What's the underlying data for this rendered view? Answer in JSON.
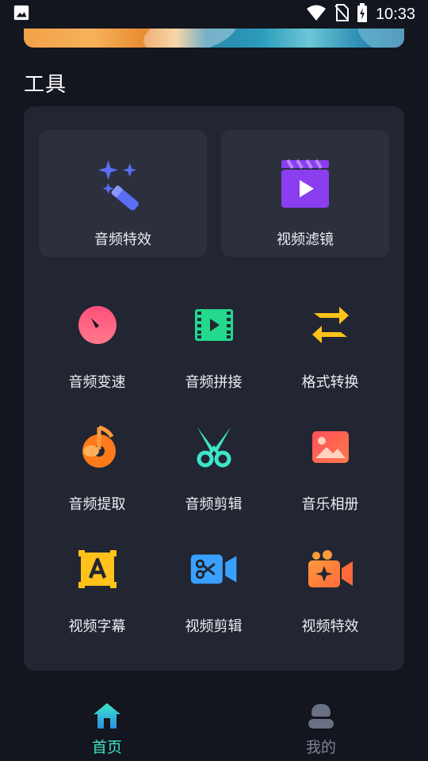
{
  "status_bar": {
    "time": "10:33",
    "icons": [
      "image-icon",
      "wifi-icon",
      "no-sim-icon",
      "battery-charging-icon"
    ]
  },
  "banner": {
    "visible": true
  },
  "tools": {
    "section_title": "工具",
    "featured": [
      {
        "label": "音频特效",
        "icon": "magic-wand-icon",
        "color": "#5b6cf5"
      },
      {
        "label": "视频滤镜",
        "icon": "clapperboard-icon",
        "color": "#8b3df0"
      }
    ],
    "grid": [
      {
        "label": "音频变速",
        "icon": "speedometer-icon",
        "color": "#ff5a8a"
      },
      {
        "label": "音频拼接",
        "icon": "film-strip-icon",
        "color": "#22d98e"
      },
      {
        "label": "格式转换",
        "icon": "swap-arrows-icon",
        "color": "#ffc21a"
      },
      {
        "label": "音频提取",
        "icon": "music-note-disc-icon",
        "color": "#ff7a1a"
      },
      {
        "label": "音频剪辑",
        "icon": "scissors-icon",
        "color": "#3ee6c8"
      },
      {
        "label": "音乐相册",
        "icon": "photo-album-icon",
        "color": "#ff5a4a"
      },
      {
        "label": "视频字幕",
        "icon": "subtitle-a-icon",
        "color": "#ffc21a"
      },
      {
        "label": "视频剪辑",
        "icon": "video-cut-icon",
        "color": "#3aa0ff"
      },
      {
        "label": "视频特效",
        "icon": "video-sparkle-icon",
        "color": "#ff8a3a"
      }
    ]
  },
  "bottom_nav": [
    {
      "label": "首页",
      "icon": "home-icon",
      "active": true
    },
    {
      "label": "我的",
      "icon": "profile-icon",
      "active": false
    }
  ]
}
